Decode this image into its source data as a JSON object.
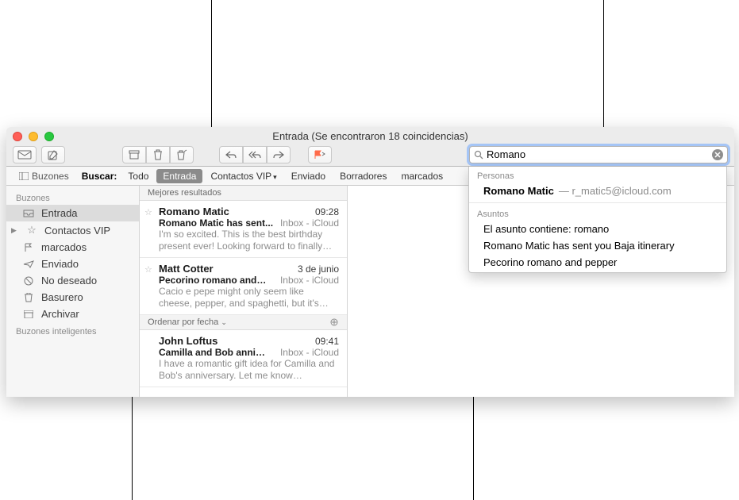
{
  "window": {
    "title": "Entrada (Se encontraron 18 coincidencias)"
  },
  "search": {
    "value": "Romano"
  },
  "scopebar": {
    "mailboxes_label": "Buzones",
    "search_label": "Buscar:",
    "items": [
      "Todo",
      "Entrada",
      "Contactos VIP",
      "Enviado",
      "Borradores",
      "marcados"
    ],
    "active_index": 1
  },
  "sidebar": {
    "section1_title": "Buzones",
    "section2_title": "Buzones inteligentes",
    "items": [
      {
        "label": "Entrada",
        "icon": "inbox"
      },
      {
        "label": "Contactos VIP",
        "icon": "star",
        "disclosure": true
      },
      {
        "label": "marcados",
        "icon": "flag"
      },
      {
        "label": "Enviado",
        "icon": "sent"
      },
      {
        "label": "No deseado",
        "icon": "junk"
      },
      {
        "label": "Basurero",
        "icon": "trash"
      },
      {
        "label": "Archivar",
        "icon": "archive"
      }
    ]
  },
  "messagelist": {
    "header1": "Mejores resultados",
    "sort_label": "Ordenar por fecha",
    "messages": [
      {
        "sender": "Romano Matic",
        "time": "09:28",
        "subject": "Romano Matic has sent...",
        "box": "Inbox - iCloud",
        "preview": "I'm so excited. This is the best birthday present ever! Looking forward to finally…",
        "star": true
      },
      {
        "sender": "Matt Cotter",
        "time": "3 de junio",
        "subject": "Pecorino romano and…",
        "box": "Inbox - iCloud",
        "preview": "Cacio e pepe might only seem like cheese, pepper, and spaghetti, but it's…",
        "star": true
      },
      {
        "sender": "John Loftus",
        "time": "09:41",
        "subject": "Camilla and Bob anni…",
        "box": "Inbox - iCloud",
        "preview": "I have a romantic gift idea for Camilla and Bob's anniversary. Let me know…",
        "star": false
      }
    ]
  },
  "suggestions": {
    "people_title": "Personas",
    "people": [
      {
        "name": "Romano Matic",
        "email": "r_matic5@icloud.com"
      }
    ],
    "subjects_title": "Asuntos",
    "subjects": [
      "El asunto contiene: romano",
      "Romano Matic has sent you Baja itinerary",
      "Pecorino romano and pepper"
    ]
  }
}
